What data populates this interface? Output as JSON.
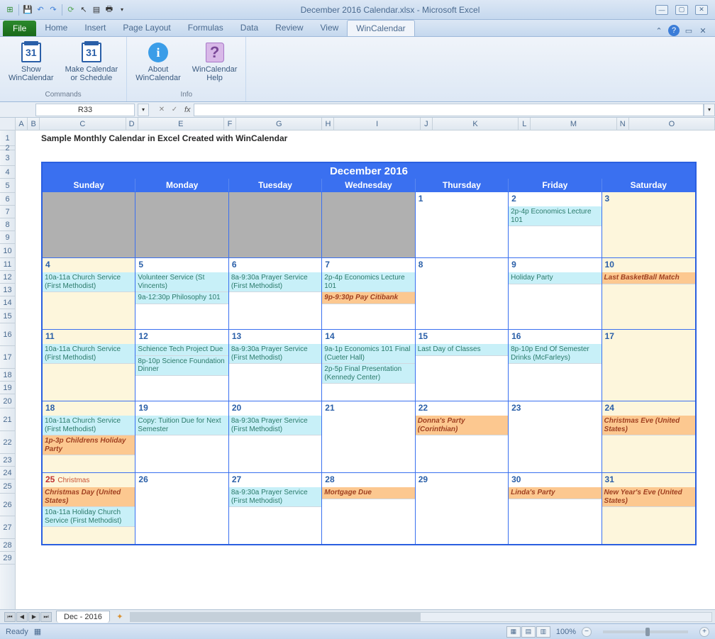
{
  "title": "December 2016 Calendar.xlsx  -  Microsoft Excel",
  "tabs": {
    "file": "File",
    "items": [
      "Home",
      "Insert",
      "Page Layout",
      "Formulas",
      "Data",
      "Review",
      "View",
      "WinCalendar"
    ],
    "active": "WinCalendar"
  },
  "ribbon": {
    "groups": [
      {
        "title": "Commands",
        "buttons": [
          {
            "label1": "Show",
            "label2": "WinCalendar",
            "icon": "31"
          },
          {
            "label1": "Make Calendar",
            "label2": "or Schedule",
            "icon": "31"
          }
        ]
      },
      {
        "title": "Info",
        "buttons": [
          {
            "label1": "About",
            "label2": "WinCalendar",
            "icon": "i"
          },
          {
            "label1": "WinCalendar",
            "label2": "Help",
            "icon": "?"
          }
        ]
      }
    ]
  },
  "name_box": "R33",
  "fx": "fx",
  "sheet_title": "Sample Monthly Calendar in Excel Created with WinCalendar",
  "columns": [
    "A",
    "B",
    "C",
    "D",
    "E",
    "F",
    "G",
    "H",
    "I",
    "J",
    "K",
    "L",
    "M",
    "N",
    "O"
  ],
  "row_nums": [
    1,
    2,
    3,
    4,
    5,
    6,
    7,
    8,
    9,
    10,
    11,
    12,
    13,
    14,
    15,
    16,
    17,
    18,
    19,
    20,
    21,
    22,
    23,
    24,
    25,
    26,
    27,
    28,
    29
  ],
  "calendar": {
    "title": "December 2016",
    "days": [
      "Sunday",
      "Monday",
      "Tuesday",
      "Wednesday",
      "Thursday",
      "Friday",
      "Saturday"
    ],
    "weeks": [
      [
        {
          "blank": true
        },
        {
          "blank": true
        },
        {
          "blank": true
        },
        {
          "blank": true
        },
        {
          "date": "1",
          "events": []
        },
        {
          "date": "2",
          "events": [
            {
              "text": "2p-4p Economics Lecture 101",
              "style": "cyan"
            }
          ]
        },
        {
          "date": "3",
          "weekend": true,
          "events": []
        }
      ],
      [
        {
          "date": "4",
          "weekend": true,
          "events": [
            {
              "text": "10a-11a Church Service (First Methodist)",
              "style": "cyan"
            }
          ]
        },
        {
          "date": "5",
          "events": [
            {
              "text": "Volunteer Service (St Vincents)",
              "style": "cyan"
            },
            {
              "text": "9a-12:30p Philosophy 101",
              "style": "cyan"
            }
          ]
        },
        {
          "date": "6",
          "events": [
            {
              "text": "8a-9:30a Prayer Service (First Methodist)",
              "style": "cyan"
            }
          ]
        },
        {
          "date": "7",
          "events": [
            {
              "text": "2p-4p Economics Lecture 101",
              "style": "cyan"
            },
            {
              "text": "9p-9:30p Pay Citibank",
              "style": "orange"
            }
          ]
        },
        {
          "date": "8",
          "events": []
        },
        {
          "date": "9",
          "events": [
            {
              "text": "Holiday Party",
              "style": "cyan"
            }
          ]
        },
        {
          "date": "10",
          "weekend": true,
          "events": [
            {
              "text": "Last BasketBall Match",
              "style": "orange"
            }
          ]
        }
      ],
      [
        {
          "date": "11",
          "weekend": true,
          "events": [
            {
              "text": "10a-11a Church Service (First Methodist)",
              "style": "cyan"
            }
          ]
        },
        {
          "date": "12",
          "events": [
            {
              "text": "Schience Tech Project Due",
              "style": "cyan"
            },
            {
              "text": "8p-10p Science Foundation Dinner",
              "style": "cyan"
            }
          ]
        },
        {
          "date": "13",
          "events": [
            {
              "text": "8a-9:30a Prayer Service (First Methodist)",
              "style": "cyan"
            }
          ]
        },
        {
          "date": "14",
          "events": [
            {
              "text": "9a-1p Economics 101 Final (Cueter Hall)",
              "style": "cyan"
            },
            {
              "text": "2p-5p Final Presentation (Kennedy Center)",
              "style": "cyan"
            }
          ]
        },
        {
          "date": "15",
          "events": [
            {
              "text": "Last Day of Classes",
              "style": "cyan"
            }
          ]
        },
        {
          "date": "16",
          "events": [
            {
              "text": "8p-10p End Of Semester Drinks (McFarleys)",
              "style": "cyan"
            }
          ]
        },
        {
          "date": "17",
          "weekend": true,
          "events": []
        }
      ],
      [
        {
          "date": "18",
          "weekend": true,
          "events": [
            {
              "text": "10a-11a Church Service (First Methodist)",
              "style": "cyan"
            },
            {
              "text": "1p-3p Childrens Holiday Party",
              "style": "orange"
            }
          ]
        },
        {
          "date": "19",
          "events": [
            {
              "text": "Copy: Tuition Due for Next Semester",
              "style": "cyan"
            }
          ]
        },
        {
          "date": "20",
          "events": [
            {
              "text": "8a-9:30a Prayer Service (First Methodist)",
              "style": "cyan"
            }
          ]
        },
        {
          "date": "21",
          "events": []
        },
        {
          "date": "22",
          "events": [
            {
              "text": "Donna's Party (Corinthian)",
              "style": "orange"
            }
          ]
        },
        {
          "date": "23",
          "events": []
        },
        {
          "date": "24",
          "weekend": true,
          "events": [
            {
              "text": "Christmas Eve (United States)",
              "style": "orange"
            }
          ]
        }
      ],
      [
        {
          "date": "25",
          "weekend": true,
          "red": true,
          "holiday": "Christmas",
          "events": [
            {
              "text": "Christmas Day (United States)",
              "style": "orange"
            },
            {
              "text": "10a-11a Holiday Church Service (First Methodist)",
              "style": "cyan"
            }
          ]
        },
        {
          "date": "26",
          "events": []
        },
        {
          "date": "27",
          "events": [
            {
              "text": "8a-9:30a Prayer Service (First Methodist)",
              "style": "cyan"
            }
          ]
        },
        {
          "date": "28",
          "events": [
            {
              "text": "Mortgage Due",
              "style": "orange"
            }
          ]
        },
        {
          "date": "29",
          "events": []
        },
        {
          "date": "30",
          "events": [
            {
              "text": "Linda's Party",
              "style": "orange"
            }
          ]
        },
        {
          "date": "31",
          "weekend": true,
          "events": [
            {
              "text": "New Year's Eve (United States)",
              "style": "orange"
            }
          ]
        }
      ]
    ]
  },
  "sheet_tab": "Dec - 2016",
  "status": "Ready",
  "zoom": "100%"
}
